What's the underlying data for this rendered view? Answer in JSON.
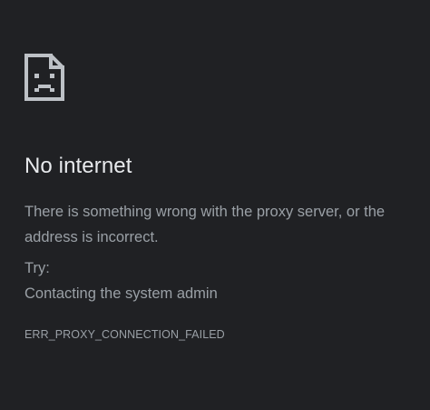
{
  "error_page": {
    "icon": "sad-document-icon",
    "title": "No internet",
    "description": "There is something wrong with the proxy server, or the address is incorrect.",
    "try_label": "Try:",
    "suggestions": [
      "Contacting the system admin"
    ],
    "error_code": "ERR_PROXY_CONNECTION_FAILED"
  },
  "colors": {
    "background": "#202124",
    "title": "#e8eaed",
    "body_text": "#9aa0a6",
    "icon": "#bdc1c6"
  }
}
